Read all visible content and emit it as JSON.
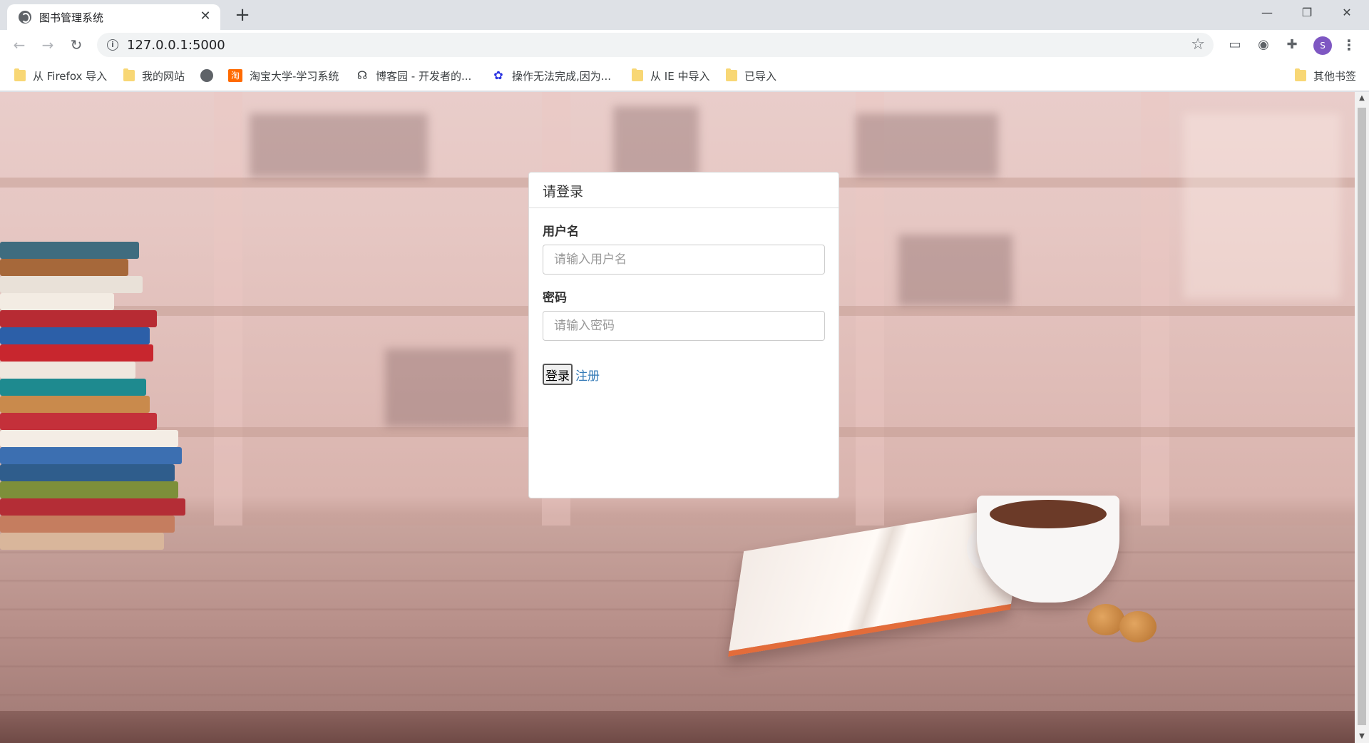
{
  "browser": {
    "tab": {
      "title": "图书管理系统",
      "favicon": "globe-icon",
      "close_glyph": "✕"
    },
    "new_tab_glyph": "+",
    "window_controls": {
      "minimize": "—",
      "restore": "❐",
      "close": "✕"
    },
    "nav": {
      "back": "←",
      "forward": "→",
      "reload": "↻"
    },
    "address": {
      "url": "127.0.0.1:5000",
      "info_glyph": "i",
      "star_glyph": "☆"
    },
    "extensions": {
      "ext1": "▭",
      "ext2": "◉",
      "ext3": "✚"
    },
    "profile_initial": "S",
    "menu_glyph": "⋮"
  },
  "bookmarks": {
    "items": [
      {
        "label": "从 Firefox 导入",
        "icon": "folder-icon"
      },
      {
        "label": "我的网站",
        "icon": "folder-icon"
      },
      {
        "label": "",
        "icon": "globe-icon"
      },
      {
        "label": "淘宝大学-学习系统",
        "icon": "taobao-icon",
        "glyph": "淘"
      },
      {
        "label": "博客园 - 开发者的...",
        "icon": "cnblogs-icon",
        "glyph": "☊"
      },
      {
        "label": "操作无法完成,因为...",
        "icon": "baidu-icon",
        "glyph": "✿"
      },
      {
        "label": "从 IE 中导入",
        "icon": "folder-icon"
      },
      {
        "label": "已导入",
        "icon": "folder-icon"
      }
    ],
    "other": {
      "label": "其他书签",
      "icon": "folder-icon"
    }
  },
  "login": {
    "heading": "请登录",
    "username_label": "用户名",
    "username_placeholder": "请输入用户名",
    "username_value": "",
    "password_label": "密码",
    "password_placeholder": "请输入密码",
    "password_value": "",
    "login_button": "登录",
    "register_link": "注册"
  },
  "scrollbar": {
    "up": "▲",
    "down": "▼"
  },
  "colors": {
    "link": "#337ab7",
    "panel_border": "#dddddd",
    "avatar": "#7e57c2",
    "folder": "#f8d775"
  }
}
